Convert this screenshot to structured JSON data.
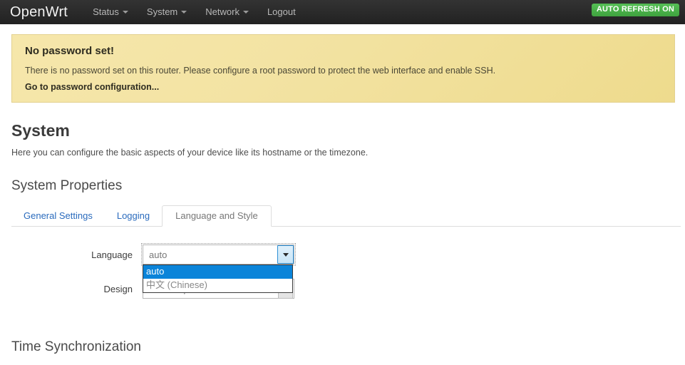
{
  "navbar": {
    "brand": "OpenWrt",
    "items": [
      {
        "label": "Status",
        "has_caret": true
      },
      {
        "label": "System",
        "has_caret": true
      },
      {
        "label": "Network",
        "has_caret": true
      },
      {
        "label": "Logout",
        "has_caret": false
      }
    ],
    "refresh_badge": "AUTO REFRESH ON",
    "badge_color": "#4bb44b",
    "background_color": "#2b2b2b"
  },
  "alert": {
    "title": "No password set!",
    "text": "There is no password set on this router. Please configure a root password to protect the web interface and enable SSH.",
    "link": "Go to password configuration...",
    "background_color": "#f1e09b"
  },
  "main": {
    "title": "System",
    "description": "Here you can configure the basic aspects of your device like its hostname or the timezone.",
    "section_legend": "System Properties",
    "bottom_legend": "Time Synchronization"
  },
  "tabs": [
    {
      "label": "General Settings",
      "active": false
    },
    {
      "label": "Logging",
      "active": false
    },
    {
      "label": "Language and Style",
      "active": true
    }
  ],
  "form": {
    "language": {
      "label": "Language",
      "value": "auto",
      "expanded": true,
      "options": [
        {
          "label": "auto",
          "selected": true
        },
        {
          "label": "中文 (Chinese)",
          "selected": false
        }
      ]
    },
    "design": {
      "label": "Design",
      "value": "Bootstrap"
    }
  },
  "colors": {
    "link": "#2a6bbd",
    "highlight": "#0b84d9"
  }
}
